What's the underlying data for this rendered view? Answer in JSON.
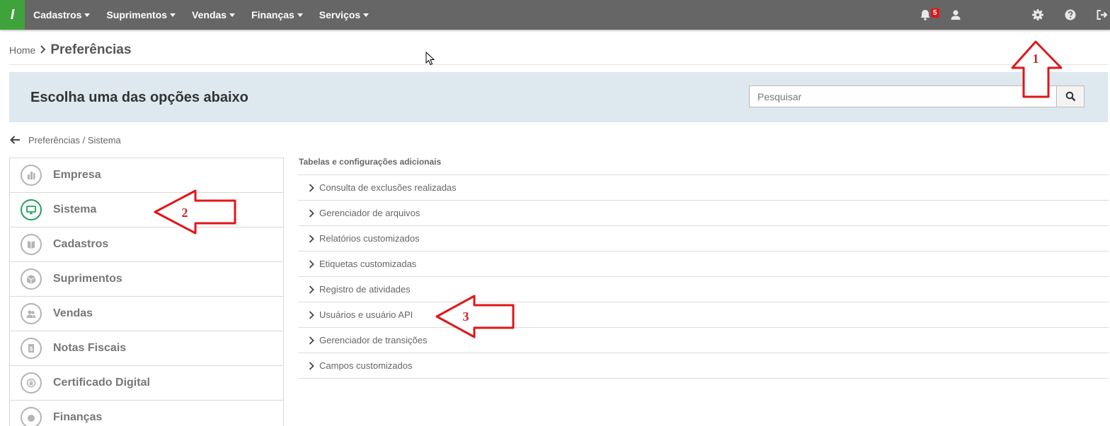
{
  "topbar": {
    "logo_text": "I",
    "menus": [
      {
        "label": "Cadastros"
      },
      {
        "label": "Suprimentos"
      },
      {
        "label": "Vendas"
      },
      {
        "label": "Finanças"
      },
      {
        "label": "Serviços"
      }
    ],
    "notification_count": "5",
    "icons": [
      "bell-icon",
      "user-icon",
      "gear-icon",
      "help-icon",
      "logout-icon"
    ]
  },
  "breadcrumb": {
    "home": "Home",
    "current": "Preferências"
  },
  "banner": {
    "title": "Escolha uma das opções abaixo",
    "search_placeholder": "Pesquisar"
  },
  "subnav": {
    "path": "Preferências / Sistema"
  },
  "sidebar": {
    "active_index": 1,
    "items": [
      {
        "label": "Empresa",
        "icon": "building-icon"
      },
      {
        "label": "Sistema",
        "icon": "monitor-icon"
      },
      {
        "label": "Cadastros",
        "icon": "book-icon"
      },
      {
        "label": "Suprimentos",
        "icon": "box-icon"
      },
      {
        "label": "Vendas",
        "icon": "people-icon"
      },
      {
        "label": "Notas Fiscais",
        "icon": "invoice-icon"
      },
      {
        "label": "Certificado Digital",
        "icon": "certificate-icon"
      },
      {
        "label": "Finanças",
        "icon": "finance-icon"
      }
    ]
  },
  "content": {
    "section_title": "Tabelas e configurações adicionais",
    "items": [
      {
        "label": "Consulta de exclusões realizadas"
      },
      {
        "label": "Gerenciador de arquivos"
      },
      {
        "label": "Relatórios customizados"
      },
      {
        "label": "Etiquetas customizadas"
      },
      {
        "label": "Registro de atividades"
      },
      {
        "label": "Usuários e usuário API"
      },
      {
        "label": "Gerenciador de transições"
      },
      {
        "label": "Campos customizados"
      }
    ]
  },
  "annotations": {
    "arrow_1": "1",
    "arrow_2": "2",
    "arrow_3": "3"
  },
  "colors": {
    "topbar": "#666666",
    "brand_green": "#3fa33c",
    "active_green": "#21a05a",
    "banner": "#dde9ef",
    "annotation_red": "#e0161a"
  }
}
